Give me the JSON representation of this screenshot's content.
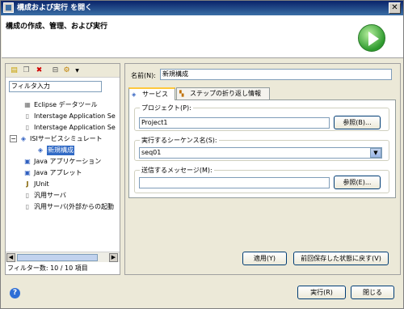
{
  "window": {
    "title": "構成および実行 を開く",
    "close_glyph": "✕"
  },
  "banner": {
    "title": "構成の作成、管理、および実行"
  },
  "toolbar": {
    "icons": [
      "new-config-icon",
      "duplicate-icon",
      "delete-icon",
      "collapse-icon",
      "filter-icon"
    ]
  },
  "filter": {
    "value": "フィルタ入力"
  },
  "tree": {
    "items": [
      {
        "label": "Eclipse データツール"
      },
      {
        "label": "Interstage Application Se"
      },
      {
        "label": "Interstage Application Se"
      },
      {
        "label": "ISIサービスシミュレート"
      },
      {
        "label": "新規構成"
      },
      {
        "label": "Java アプリケーション"
      },
      {
        "label": "Java アプレット"
      },
      {
        "label": "JUnit"
      },
      {
        "label": "汎用サーバ"
      },
      {
        "label": "汎用サーバ(外部からの起動"
      }
    ]
  },
  "status": {
    "filter_count": "フィルター数: 10 / 10 項目"
  },
  "form": {
    "name_label": "名前(N):",
    "name_value": "新規構成",
    "tabs": [
      {
        "label": "サービス"
      },
      {
        "label": "ステップの折り返し情報"
      }
    ],
    "project_label": "プロジェクト(P):",
    "project_value": "Project1",
    "browse1": "参照(B)...",
    "sequence_label": "実行するシーケンス名(S):",
    "sequence_value": "seq01",
    "message_label": "送信するメッセージ(M):",
    "message_value": "",
    "browse2": "参照(E)...",
    "apply": "適用(Y)",
    "revert": "前回保存した状態に戻す(V)"
  },
  "footer": {
    "run": "実行(R)",
    "close": "閉じる"
  }
}
